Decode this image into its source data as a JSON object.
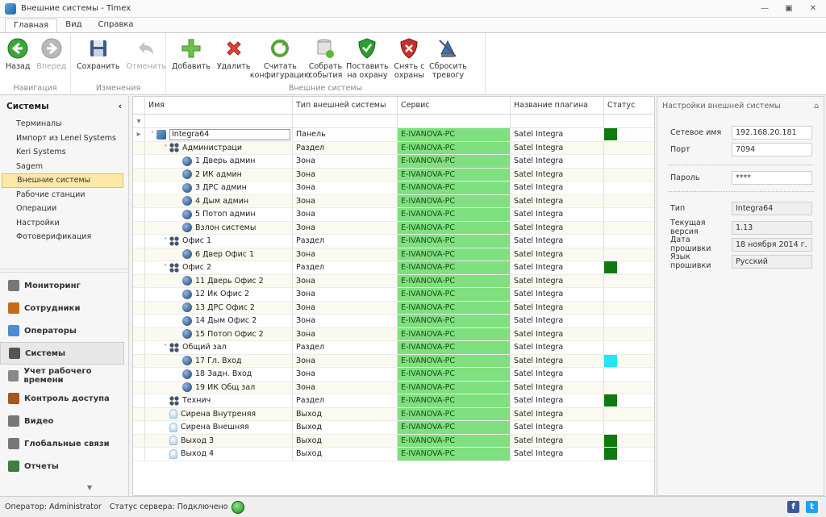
{
  "window": {
    "title": "Внешние системы - Timex"
  },
  "ribbon_tabs": [
    "Главная",
    "Вид",
    "Справка"
  ],
  "ribbon": {
    "nav": {
      "label": "Навигация",
      "back": "Назад",
      "forward": "Вперед"
    },
    "changes": {
      "label": "Изменения",
      "save": "Сохранить",
      "undo": "Отменить"
    },
    "ext": {
      "label": "Внешние системы",
      "add": "Добавить",
      "delete": "Удалить",
      "read_config": "Считать конфигурацию",
      "collect_events": "Собрать события",
      "arm": "Поставить на охрану",
      "disarm": "Снять с охраны",
      "reset_alarm": "Сбросить тревогу"
    }
  },
  "left": {
    "header": "Системы",
    "items": [
      "Терминалы",
      "Импорт из Lenel Systems",
      "Keri Systems",
      "Sagem",
      "Внешние системы",
      "Рабочие станции",
      "Операции",
      "Настройки",
      "Фотоверификация"
    ],
    "selected_index": 4,
    "nav": [
      "Мониторинг",
      "Сотрудники",
      "Операторы",
      "Системы",
      "Учет рабочего времени",
      "Контроль доступа",
      "Видео",
      "Глобальные связи",
      "Отчеты"
    ],
    "nav_selected": 3
  },
  "grid": {
    "columns": [
      "Имя",
      "Тип внешней системы",
      "Сервис",
      "Название плагина",
      "Статус"
    ],
    "rows": [
      {
        "name": "Integra64",
        "type": "Панель",
        "service": "E-IVANOVA-PC",
        "plugin": "Satel Integra",
        "status": "green",
        "level": 0,
        "icon": "panel",
        "exp": "v",
        "arrow": true
      },
      {
        "name": "Администраци",
        "type": "Раздел",
        "service": "E-IVANOVA-PC",
        "plugin": "Satel Integra",
        "status": "",
        "level": 1,
        "icon": "part",
        "exp": "v"
      },
      {
        "name": "1 Дверь админ",
        "type": "Зона",
        "service": "E-IVANOVA-PC",
        "plugin": "Satel Integra",
        "status": "",
        "level": 2,
        "icon": "zone"
      },
      {
        "name": "2 ИК админ",
        "type": "Зона",
        "service": "E-IVANOVA-PC",
        "plugin": "Satel Integra",
        "status": "",
        "level": 2,
        "icon": "zone"
      },
      {
        "name": "3 ДРС админ",
        "type": "Зона",
        "service": "E-IVANOVA-PC",
        "plugin": "Satel Integra",
        "status": "",
        "level": 2,
        "icon": "zone"
      },
      {
        "name": "4 Дым админ",
        "type": "Зона",
        "service": "E-IVANOVA-PC",
        "plugin": "Satel Integra",
        "status": "",
        "level": 2,
        "icon": "zone"
      },
      {
        "name": "5 Потоп админ",
        "type": "Зона",
        "service": "E-IVANOVA-PC",
        "plugin": "Satel Integra",
        "status": "",
        "level": 2,
        "icon": "zone"
      },
      {
        "name": "Взлон системы",
        "type": "Зона",
        "service": "E-IVANOVA-PC",
        "plugin": "Satel Integra",
        "status": "",
        "level": 2,
        "icon": "zone"
      },
      {
        "name": "Офис 1",
        "type": "Раздел",
        "service": "E-IVANOVA-PC",
        "plugin": "Satel Integra",
        "status": "",
        "level": 1,
        "icon": "part",
        "exp": "v"
      },
      {
        "name": "6 Двер Офис 1",
        "type": "Зона",
        "service": "E-IVANOVA-PC",
        "plugin": "Satel Integra",
        "status": "",
        "level": 2,
        "icon": "zone"
      },
      {
        "name": "Офис 2",
        "type": "Раздел",
        "service": "E-IVANOVA-PC",
        "plugin": "Satel Integra",
        "status": "green",
        "level": 1,
        "icon": "part",
        "exp": "v"
      },
      {
        "name": "11 Дверь Офис 2",
        "type": "Зона",
        "service": "E-IVANOVA-PC",
        "plugin": "Satel Integra",
        "status": "",
        "level": 2,
        "icon": "zone"
      },
      {
        "name": "12 Ик Офис 2",
        "type": "Зона",
        "service": "E-IVANOVA-PC",
        "plugin": "Satel Integra",
        "status": "",
        "level": 2,
        "icon": "zone"
      },
      {
        "name": "13 ДРС Офис 2",
        "type": "Зона",
        "service": "E-IVANOVA-PC",
        "plugin": "Satel Integra",
        "status": "",
        "level": 2,
        "icon": "zone"
      },
      {
        "name": "14 Дым Офис 2",
        "type": "Зона",
        "service": "E-IVANOVA-PC",
        "plugin": "Satel Integra",
        "status": "",
        "level": 2,
        "icon": "zone"
      },
      {
        "name": "15 Потоп Офис 2",
        "type": "Зона",
        "service": "E-IVANOVA-PC",
        "plugin": "Satel Integra",
        "status": "",
        "level": 2,
        "icon": "zone"
      },
      {
        "name": "Общий зал",
        "type": "Раздел",
        "service": "E-IVANOVA-PC",
        "plugin": "Satel Integra",
        "status": "",
        "level": 1,
        "icon": "part",
        "exp": "v"
      },
      {
        "name": "17 Гл. Вход",
        "type": "Зона",
        "service": "E-IVANOVA-PC",
        "plugin": "Satel Integra",
        "status": "cyan",
        "level": 2,
        "icon": "zone"
      },
      {
        "name": "18 Задн. Вход",
        "type": "Зона",
        "service": "E-IVANOVA-PC",
        "plugin": "Satel Integra",
        "status": "",
        "level": 2,
        "icon": "zone"
      },
      {
        "name": "19 ИК Общ зал",
        "type": "Зона",
        "service": "E-IVANOVA-PC",
        "plugin": "Satel Integra",
        "status": "",
        "level": 2,
        "icon": "zone"
      },
      {
        "name": "Технич",
        "type": "Раздел",
        "service": "E-IVANOVA-PC",
        "plugin": "Satel Integra",
        "status": "green",
        "level": 1,
        "icon": "part"
      },
      {
        "name": "Сирена Внутреняя",
        "type": "Выход",
        "service": "E-IVANOVA-PC",
        "plugin": "Satel Integra",
        "status": "",
        "level": 1,
        "icon": "out"
      },
      {
        "name": "Сирена Внешняя",
        "type": "Выход",
        "service": "E-IVANOVA-PC",
        "plugin": "Satel Integra",
        "status": "",
        "level": 1,
        "icon": "out"
      },
      {
        "name": "Выход   3",
        "type": "Выход",
        "service": "E-IVANOVA-PC",
        "plugin": "Satel Integra",
        "status": "green",
        "level": 1,
        "icon": "out"
      },
      {
        "name": "Выход   4",
        "type": "Выход",
        "service": "E-IVANOVA-PC",
        "plugin": "Satel Integra",
        "status": "green",
        "level": 1,
        "icon": "out"
      }
    ]
  },
  "right": {
    "header": "Настройки внешней системы",
    "network_name_label": "Сетевое имя",
    "network_name": "192.168.20.181",
    "port_label": "Порт",
    "port": "7094",
    "password_label": "Пароль",
    "password": "****",
    "type_label": "Тип",
    "type": "Integra64",
    "version_label": "Текущая версия",
    "version": "1.13",
    "firmware_date_label": "Дата прошивки",
    "firmware_date": "18 ноября 2014 г.",
    "firmware_lang_label": "Язык прошивки",
    "firmware_lang": "Русский"
  },
  "status": {
    "operator": "Оператор: Administrator",
    "server": "Статус сервера: Подключено"
  },
  "colors": {
    "green": "#0f7a0f",
    "cyan": "#22e6f0",
    "service_bg": "#7ee07e"
  }
}
